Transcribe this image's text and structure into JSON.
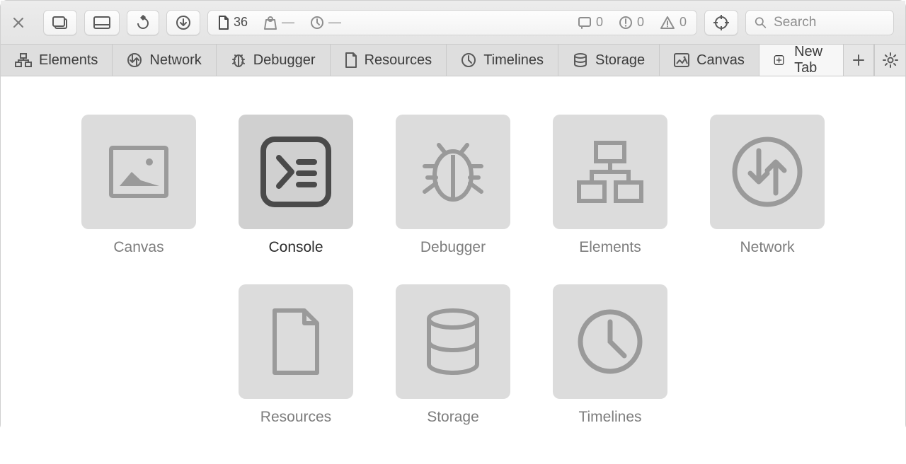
{
  "toolbar": {
    "page_count": "36",
    "weight_count": "—",
    "clock_count": "—",
    "messages_count": "0",
    "issues_count": "0",
    "warnings_count": "0",
    "search_placeholder": "Search"
  },
  "tabs": [
    {
      "label": "Elements",
      "icon": "elements"
    },
    {
      "label": "Network",
      "icon": "network"
    },
    {
      "label": "Debugger",
      "icon": "debugger"
    },
    {
      "label": "Resources",
      "icon": "resources"
    },
    {
      "label": "Timelines",
      "icon": "timelines"
    },
    {
      "label": "Storage",
      "icon": "storage"
    },
    {
      "label": "Canvas",
      "icon": "canvas"
    }
  ],
  "new_tab_label": "New Tab",
  "tiles": [
    {
      "label": "Canvas",
      "icon": "canvas",
      "selected": false
    },
    {
      "label": "Console",
      "icon": "console",
      "selected": true
    },
    {
      "label": "Debugger",
      "icon": "debugger",
      "selected": false
    },
    {
      "label": "Elements",
      "icon": "elements",
      "selected": false
    },
    {
      "label": "Network",
      "icon": "network",
      "selected": false
    },
    {
      "label": "Resources",
      "icon": "resources",
      "selected": false
    },
    {
      "label": "Storage",
      "icon": "storage",
      "selected": false
    },
    {
      "label": "Timelines",
      "icon": "timelines",
      "selected": false
    }
  ]
}
